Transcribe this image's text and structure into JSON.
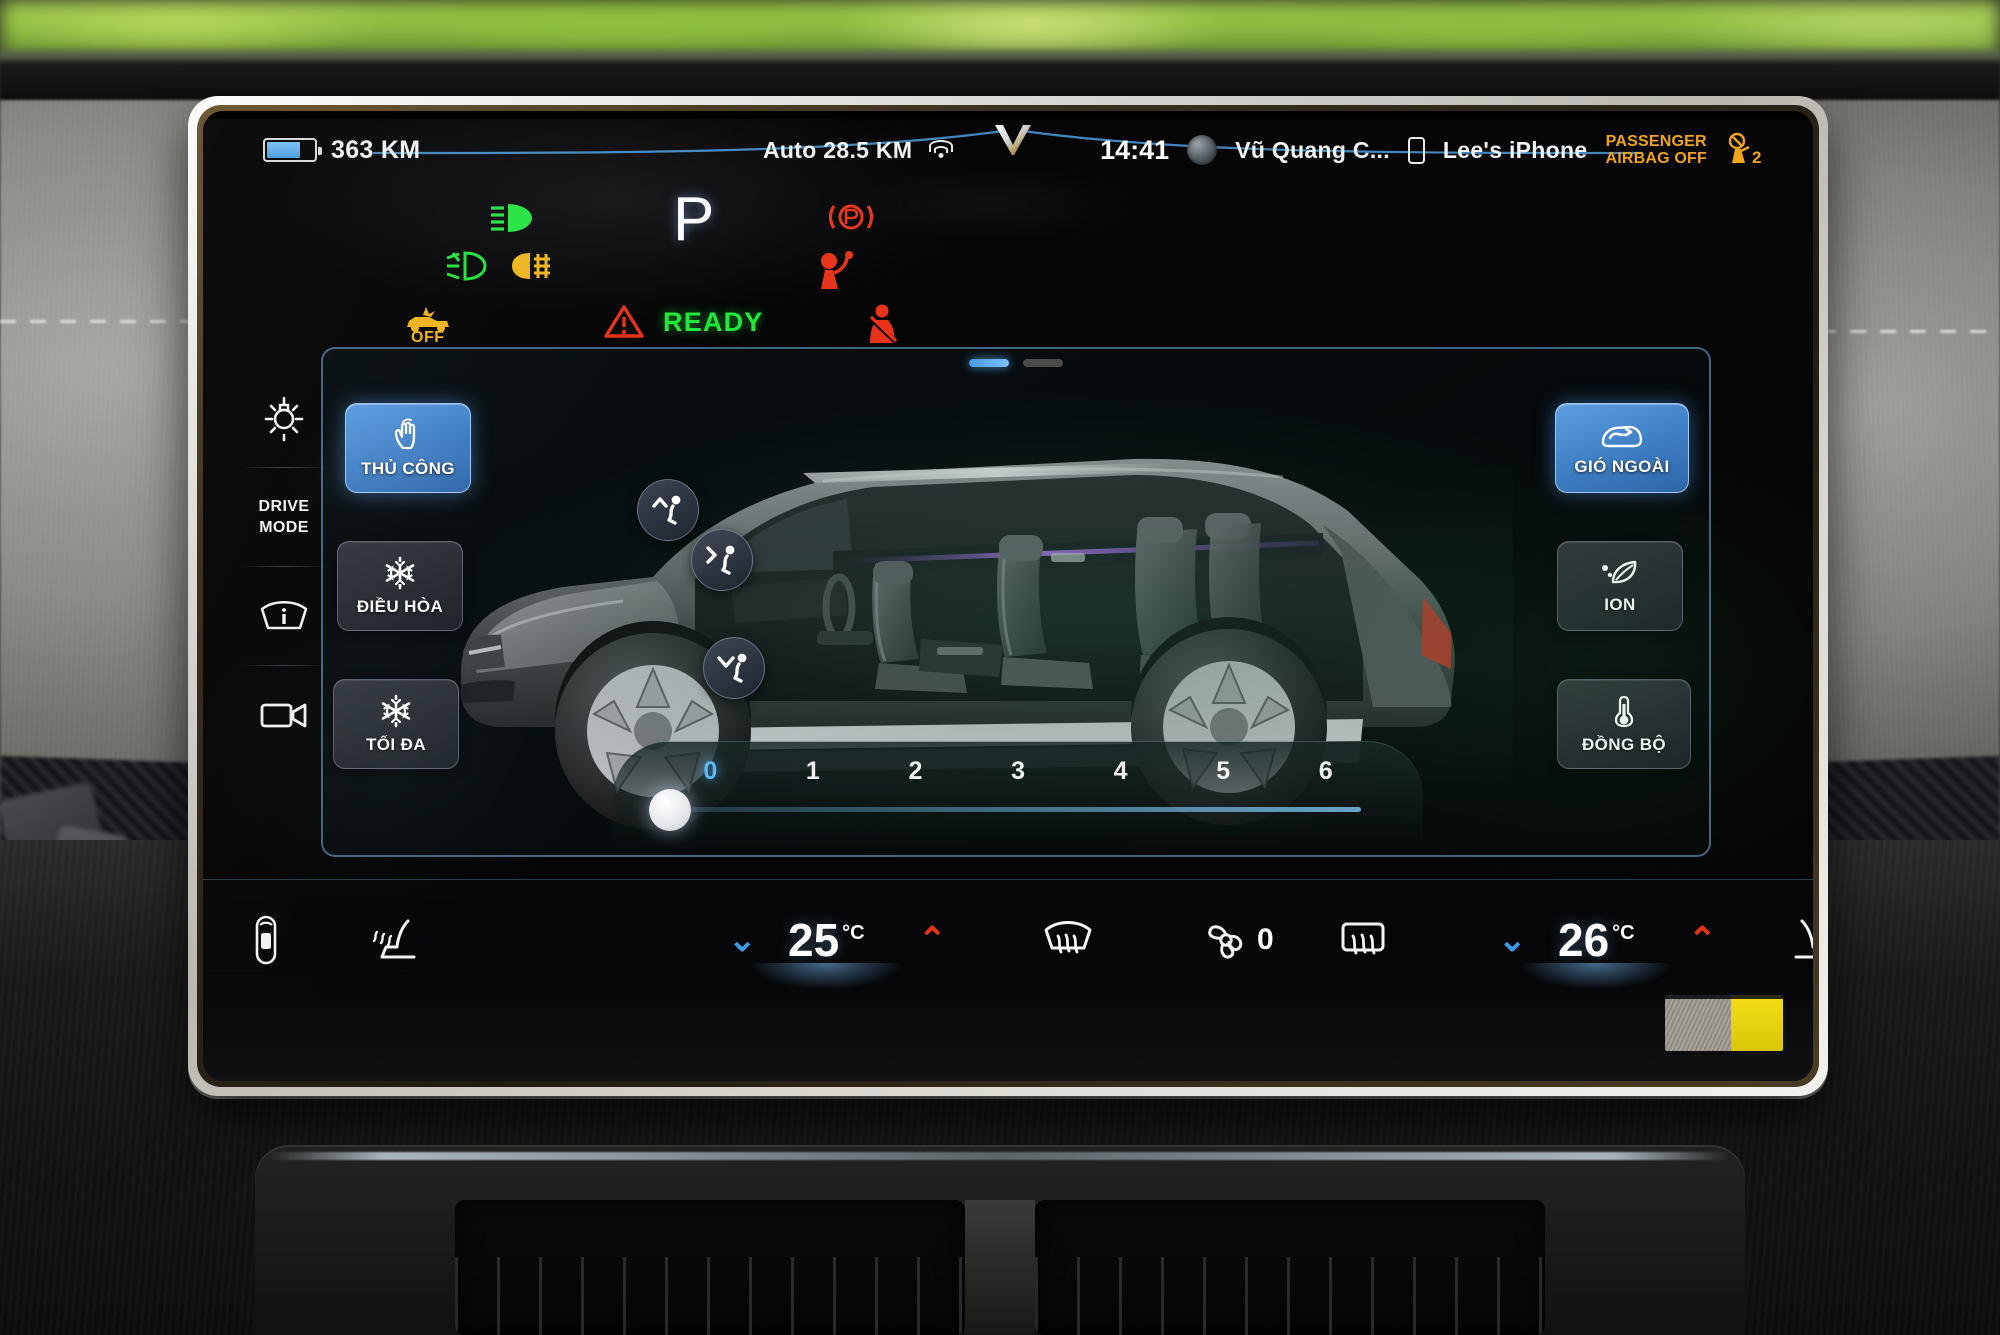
{
  "status_bar": {
    "range_value": "363 KM",
    "battery_icon": "battery-icon",
    "auto_distance": "Auto 28.5 KM",
    "wifi_icon": "wifi-icon",
    "brand_logo": "vinfast-v-logo",
    "time": "14:41",
    "avatar_icon": "user-avatar",
    "user_name": "Vũ Quang C...",
    "phone_icon": "phone-icon",
    "device_name": "Lee's iPhone",
    "airbag_line1": "PASSENGER",
    "airbag_line2": "AIRBAG OFF",
    "occupant_icon": "passenger-airbag-off-icon",
    "occupant_count": "2"
  },
  "telltales": {
    "high_beam": {
      "name": "high-beam-icon",
      "color": "#1fe53a"
    },
    "front_fog": {
      "name": "front-fog-lamp-icon",
      "color": "#1fe53a"
    },
    "rear_fog": {
      "name": "rear-fog-lamp-icon",
      "color": "#f0b41c"
    },
    "traction_off": {
      "name": "traction-control-off-icon",
      "color": "#f0b41c",
      "label": "OFF"
    },
    "warning": {
      "name": "general-warning-icon",
      "color": "#e8321a"
    },
    "gear": "P",
    "ready_text": "READY",
    "airbag_warn": {
      "name": "airbag-warning-icon",
      "color": "#e8321a"
    },
    "seatbelt": {
      "name": "seatbelt-warning-icon",
      "color": "#e8321a"
    },
    "park_brake": {
      "name": "parking-brake-icon",
      "color": "#e8321a"
    }
  },
  "left_rail": {
    "items": [
      {
        "icon": "brightness-icon",
        "label": ""
      },
      {
        "icon": "drive-mode-icon",
        "label_line1": "DRIVE",
        "label_line2": "MODE"
      },
      {
        "icon": "windshield-info-icon",
        "label": ""
      },
      {
        "icon": "camera-icon",
        "label": ""
      }
    ]
  },
  "climate": {
    "page_indicator": {
      "total": 2,
      "active": 1
    },
    "left_buttons": [
      {
        "icon": "hand-touch-icon",
        "label": "THỦ CÔNG",
        "active": true
      },
      {
        "icon": "snowflake-icon",
        "label": "ĐIỀU HÒA",
        "active": false
      },
      {
        "icon": "snowflake-icon",
        "label": "TỐI ĐA",
        "active": false
      }
    ],
    "right_buttons": [
      {
        "icon": "fresh-air-circulation-icon",
        "label": "GIÓ NGOÀI",
        "active": true
      },
      {
        "icon": "ion-leaf-icon",
        "label": "ION",
        "active": false
      },
      {
        "icon": "thermometer-sync-icon",
        "label": "ĐỒNG BỘ",
        "active": false
      }
    ],
    "airflow_buttons": [
      {
        "icon": "airflow-defrost-icon",
        "name": "airflow-up"
      },
      {
        "icon": "airflow-face-icon",
        "name": "airflow-face"
      },
      {
        "icon": "airflow-feet-icon",
        "name": "airflow-feet"
      }
    ],
    "fan_slider": {
      "ticks": [
        "0",
        "1",
        "2",
        "3",
        "4",
        "5",
        "6"
      ],
      "current": "0",
      "accent": "#5fb8f5"
    },
    "vehicle_image": "suv-cutaway-side-view"
  },
  "bottom_bar": {
    "car_status_icon": "car-top-view-icon",
    "left_seat_icon": "driver-seat-heater-icon",
    "left_temp": {
      "down": "⌄",
      "value": "25",
      "unit": "°C",
      "up": "⌃"
    },
    "front_defrost_icon": "front-defrost-icon",
    "fan_icon": "fan-icon",
    "fan_value": "0",
    "rear_defrost_icon": "rear-defrost-icon",
    "right_temp": {
      "down": "⌄",
      "value": "26",
      "unit": "°C",
      "up": "⌃"
    },
    "right_seat_icon": "passenger-seat-heater-icon",
    "apps_icon": "apps-grid-icon"
  },
  "colors": {
    "accent_blue": "#3f7fc6",
    "green": "#1fe53a",
    "amber": "#f0b41c",
    "red": "#e8321a",
    "slider_blue": "#5fb8f5"
  }
}
